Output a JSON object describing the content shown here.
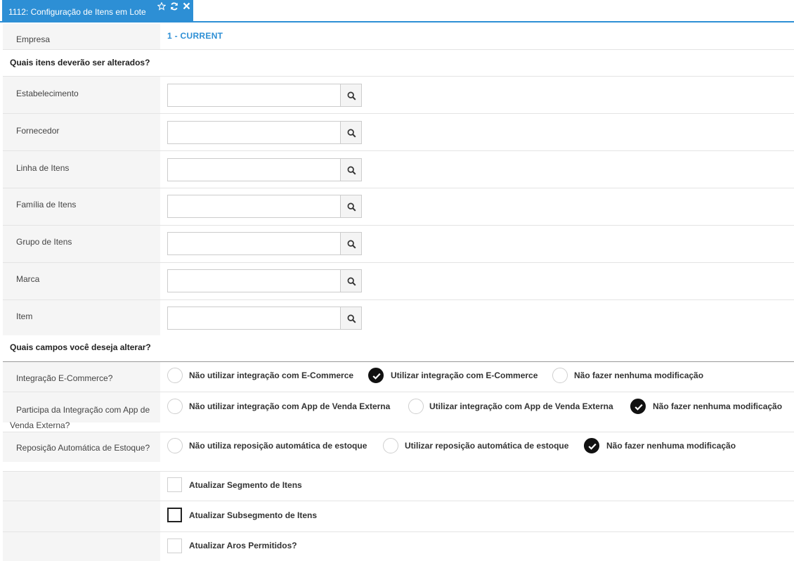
{
  "tab": {
    "title": "1112: Configuração de Itens em Lote",
    "icons": [
      "star-icon",
      "refresh-icon",
      "close-icon"
    ],
    "accent": "#2d8fd5"
  },
  "empresa": {
    "label": "Empresa",
    "value": "1 - CURRENT"
  },
  "section1": {
    "title": "Quais itens deverão ser alterados?"
  },
  "lookups": [
    {
      "label": "Estabelecimento",
      "value": ""
    },
    {
      "label": "Fornecedor",
      "value": ""
    },
    {
      "label": "Linha de Itens",
      "value": ""
    },
    {
      "label": "Família de Itens",
      "value": ""
    },
    {
      "label": "Grupo de Itens",
      "value": ""
    },
    {
      "label": "Marca",
      "value": ""
    },
    {
      "label": "Item",
      "value": ""
    }
  ],
  "section2": {
    "title": "Quais campos você deseja alterar?"
  },
  "radio_groups": [
    {
      "label": "Integração E-Commerce?",
      "options": [
        "Não utilizar integração com E-Commerce",
        "Utilizar integração com E-Commerce",
        "Não fazer nenhuma modificação"
      ],
      "selected": 1
    },
    {
      "label": "Participa da Integração com App de Venda Externa?",
      "options": [
        "Não utilizar integração com App de Venda Externa",
        "Utilizar integração com App de Venda Externa",
        "Não fazer nenhuma modificação"
      ],
      "selected": 2
    },
    {
      "label": "Reposição Automática de Estoque?",
      "options": [
        "Não utiliza reposição automática de estoque",
        "Utilizar reposição automática de estoque",
        "Não fazer nenhuma modificação"
      ],
      "selected": 2
    }
  ],
  "checkboxes": [
    {
      "label": "Atualizar Segmento de Itens",
      "checked": false
    },
    {
      "label": "Atualizar Subsegmento de Itens",
      "checked": false,
      "focused": true
    },
    {
      "label": "Atualizar Aros Permitidos?",
      "checked": false
    }
  ]
}
